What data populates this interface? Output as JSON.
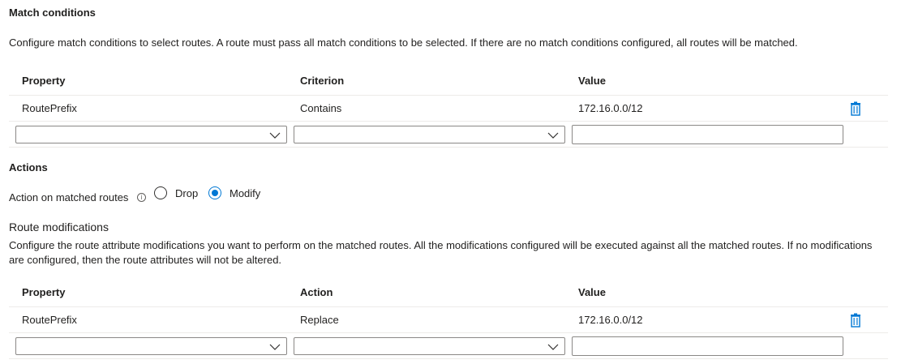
{
  "match_conditions": {
    "heading": "Match conditions",
    "description": "Configure match conditions to select routes. A route must pass all match conditions to be selected. If there are no match conditions configured, all routes will be matched.",
    "columns": [
      "Property",
      "Criterion",
      "Value"
    ],
    "rows": [
      {
        "property": "RoutePrefix",
        "criterion": "Contains",
        "value": "172.16.0.0/12"
      }
    ],
    "new_row": {
      "property": "",
      "criterion": "",
      "value": ""
    }
  },
  "actions": {
    "heading": "Actions",
    "label": "Action on matched routes",
    "info_icon": "info-icon",
    "options": [
      {
        "label": "Drop",
        "selected": false
      },
      {
        "label": "Modify",
        "selected": true
      }
    ]
  },
  "route_modifications": {
    "heading": "Route modifications",
    "description_line1": "Configure the route attribute modifications you want to perform on the matched routes. All the modifications configured will be executed against all the matched routes. If no modifications",
    "description_line2": "are configured, then the route attributes will not be altered.",
    "columns": [
      "Property",
      "Action",
      "Value"
    ],
    "rows": [
      {
        "property": "RoutePrefix",
        "action": "Replace",
        "value": "172.16.0.0/12"
      }
    ],
    "new_row": {
      "property": "",
      "action": "",
      "value": ""
    }
  },
  "colors": {
    "accent": "#0078d4",
    "text": "#201f1e",
    "border": "#8a8886",
    "rule": "#edebe9"
  }
}
